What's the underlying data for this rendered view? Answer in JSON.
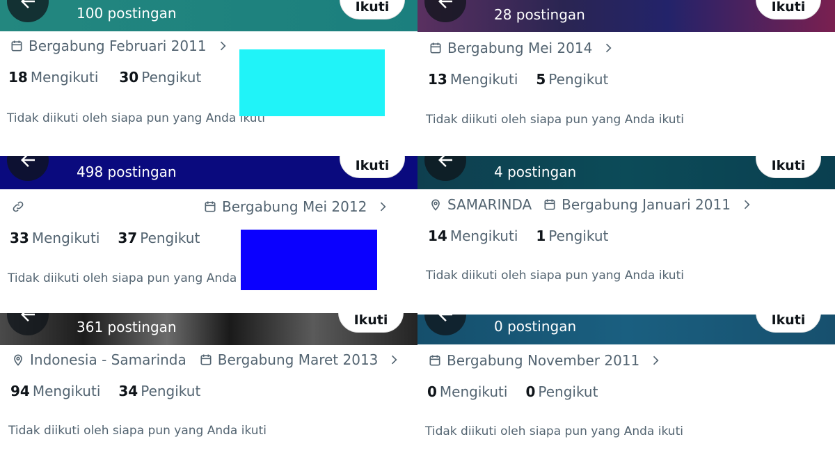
{
  "colors": {
    "redact_cyan": "#20f3f8",
    "redact_blue": "#0a00ff"
  },
  "profiles": [
    {
      "post_count": "100 postingan",
      "follow_label": "Ikuti",
      "joined": "Bergabung Februari 2011",
      "following_count": "18",
      "following_label": "Mengikuti",
      "followers_count": "30",
      "followers_label": "Pengikut",
      "note": "Tidak diikuti oleh siapa pun yang Anda ikuti",
      "header_color": "#1f857f"
    },
    {
      "post_count": "28 postingan",
      "follow_label": "Ikuti",
      "joined": "Bergabung Mei 2014",
      "following_count": "13",
      "following_label": "Mengikuti",
      "followers_count": "5",
      "followers_label": "Pengikut",
      "note": "Tidak diikuti oleh siapa pun yang Anda ikuti",
      "header_color": "#4a2a55"
    },
    {
      "post_count": "498 postingan",
      "follow_label": "Ikuti",
      "joined": "Bergabung Mei 2012",
      "following_count": "33",
      "following_label": "Mengikuti",
      "followers_count": "37",
      "followers_label": "Pengikut",
      "note": "Tidak diikuti oleh siapa pun yang Anda ikuti",
      "header_color": "#0a0a7a"
    },
    {
      "post_count": "4 postingan",
      "follow_label": "Ikuti",
      "location": "SAMARINDA",
      "joined": "Bergabung Januari 2011",
      "following_count": "14",
      "following_label": "Mengikuti",
      "followers_count": "1",
      "followers_label": "Pengikut",
      "note": "Tidak diikuti oleh siapa pun yang Anda ikuti",
      "header_color": "#0c4654"
    },
    {
      "post_count": "361 postingan",
      "follow_label": "Ikuti",
      "location": "Indonesia - Samarinda",
      "joined": "Bergabung Maret 2013",
      "following_count": "94",
      "following_label": "Mengikuti",
      "followers_count": "34",
      "followers_label": "Pengikut",
      "note": "Tidak diikuti oleh siapa pun yang Anda ikuti",
      "header_color": "#2e2e2e"
    },
    {
      "post_count": "0 postingan",
      "follow_label": "Ikuti",
      "joined": "Bergabung November 2011",
      "following_count": "0",
      "following_label": "Mengikuti",
      "followers_count": "0",
      "followers_label": "Pengikut",
      "note": "Tidak diikuti oleh siapa pun yang Anda ikuti",
      "header_color": "#17506e"
    }
  ]
}
